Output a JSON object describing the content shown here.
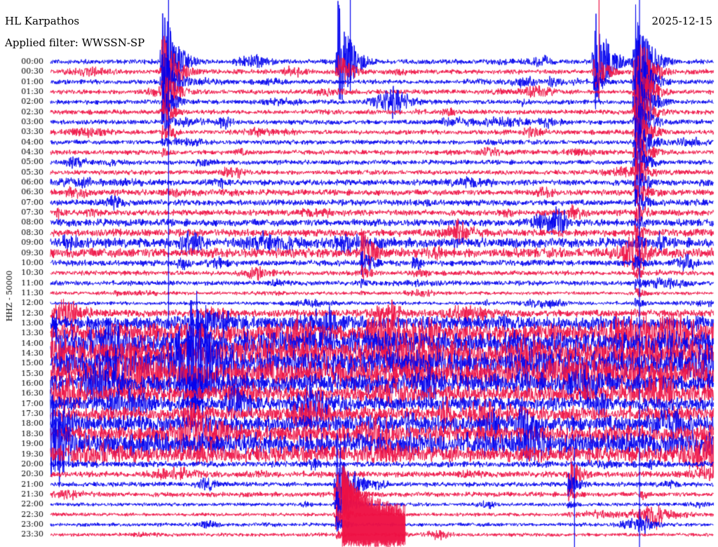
{
  "header": {
    "station": "HL Karpathos",
    "filter": "Applied filter: WWSSN-SP",
    "date": "2025-12-15"
  },
  "chart_data": {
    "type": "line",
    "title": "HL Karpathos",
    "ylabel": "HHZ - 50000",
    "row_labels": [
      "00:00",
      "00:30",
      "01:00",
      "01:30",
      "02:00",
      "02:30",
      "03:00",
      "03:30",
      "04:00",
      "04:30",
      "05:00",
      "05:30",
      "06:00",
      "06:30",
      "07:00",
      "07:30",
      "08:00",
      "08:30",
      "09:00",
      "09:30",
      "10:00",
      "10:30",
      "11:00",
      "11:30",
      "12:00",
      "12:30",
      "13:00",
      "13:30",
      "14:00",
      "14:30",
      "15:00",
      "15:30",
      "16:00",
      "16:30",
      "17:00",
      "17:30",
      "18:00",
      "18:30",
      "19:00",
      "19:30",
      "20:00",
      "20:30",
      "21:00",
      "21:30",
      "22:00",
      "22:30",
      "23:00",
      "23:30"
    ],
    "row_noise_amplitude": [
      4,
      4,
      4,
      4,
      4,
      4,
      4,
      4,
      4,
      4,
      4,
      4,
      5,
      5,
      5,
      5,
      6,
      6,
      8,
      8,
      5,
      4,
      4,
      3,
      3,
      6,
      12,
      16,
      20,
      22,
      22,
      22,
      16,
      14,
      12,
      12,
      14,
      15,
      18,
      14,
      5,
      5,
      4,
      4,
      3,
      3,
      3,
      3
    ],
    "series_colors": [
      "#0000ee",
      "#ee1144"
    ],
    "events": [
      {
        "x_fraction": 0.168,
        "row": 0,
        "peak": 95,
        "decay_rows": 10
      },
      {
        "x_fraction": 0.433,
        "row": 0,
        "peak": 90,
        "decay_rows": 2
      },
      {
        "x_fraction": 0.819,
        "row": 0,
        "peak": 88,
        "decay_rows": 3
      },
      {
        "x_fraction": 0.881,
        "row": 0,
        "peak": 95,
        "decay_rows": 28
      },
      {
        "x_fraction": 0.468,
        "row": 19,
        "peak": 40,
        "decay_rows": 5
      },
      {
        "x_fraction": 0.78,
        "row": 41,
        "peak": 30,
        "decay_rows": 6
      },
      {
        "x_fraction": 0.43,
        "row": 42,
        "peak": 90,
        "decay_rows": 6
      }
    ]
  }
}
